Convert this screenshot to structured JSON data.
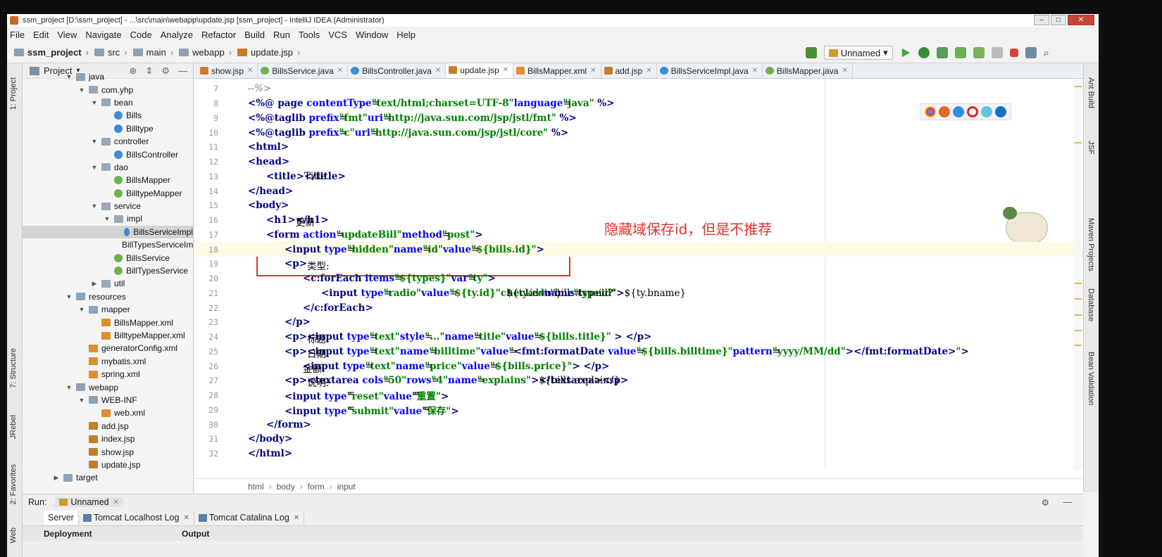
{
  "window": {
    "title": "ssm_project [D:\\ssm_project] - ...\\src\\main\\webapp\\update.jsp [ssm_project] - IntelliJ IDEA (Administrator)"
  },
  "menu": [
    "File",
    "Edit",
    "View",
    "Navigate",
    "Code",
    "Analyze",
    "Refactor",
    "Build",
    "Run",
    "Tools",
    "VCS",
    "Window",
    "Help"
  ],
  "nav": {
    "crumbs": [
      "ssm_project",
      "src",
      "main",
      "webapp",
      "update.jsp"
    ],
    "run_config": "Unnamed"
  },
  "left_tabs": [
    "1: Project",
    "7: Structure",
    "JRebel",
    "2: Favorites",
    "Web"
  ],
  "right_tabs": [
    "Ant Build",
    "JSF",
    "Maven Projects",
    "Database",
    "Bean Validation"
  ],
  "project": {
    "header": "Project",
    "tree": [
      {
        "label": "java",
        "indent": 0,
        "arrow": "down",
        "icon": "folder"
      },
      {
        "label": "com.yhp",
        "indent": 1,
        "arrow": "down",
        "icon": "pkg"
      },
      {
        "label": "bean",
        "indent": 2,
        "arrow": "down",
        "icon": "pkg"
      },
      {
        "label": "Bills",
        "indent": 3,
        "arrow": "",
        "icon": "cls"
      },
      {
        "label": "Billtype",
        "indent": 3,
        "arrow": "",
        "icon": "cls"
      },
      {
        "label": "controller",
        "indent": 2,
        "arrow": "down",
        "icon": "pkg"
      },
      {
        "label": "BillsController",
        "indent": 3,
        "arrow": "",
        "icon": "cls"
      },
      {
        "label": "dao",
        "indent": 2,
        "arrow": "down",
        "icon": "pkg"
      },
      {
        "label": "BillsMapper",
        "indent": 3,
        "arrow": "",
        "icon": "iface"
      },
      {
        "label": "BilltypeMapper",
        "indent": 3,
        "arrow": "",
        "icon": "iface"
      },
      {
        "label": "service",
        "indent": 2,
        "arrow": "down",
        "icon": "pkg"
      },
      {
        "label": "impl",
        "indent": 3,
        "arrow": "down",
        "icon": "pkg"
      },
      {
        "label": "BillsServiceImpl",
        "indent": 4,
        "arrow": "",
        "icon": "cls",
        "selected": true
      },
      {
        "label": "BillTypesServiceImpl",
        "indent": 4,
        "arrow": "",
        "icon": "cls"
      },
      {
        "label": "BillsService",
        "indent": 3,
        "arrow": "",
        "icon": "iface"
      },
      {
        "label": "BillTypesService",
        "indent": 3,
        "arrow": "",
        "icon": "iface"
      },
      {
        "label": "util",
        "indent": 2,
        "arrow": "right",
        "icon": "pkg"
      },
      {
        "label": "resources",
        "indent": 0,
        "arrow": "down",
        "icon": "folder"
      },
      {
        "label": "mapper",
        "indent": 1,
        "arrow": "down",
        "icon": "folder"
      },
      {
        "label": "BillsMapper.xml",
        "indent": 2,
        "arrow": "",
        "icon": "xml"
      },
      {
        "label": "BilltypeMapper.xml",
        "indent": 2,
        "arrow": "",
        "icon": "xml"
      },
      {
        "label": "generatorConfig.xml",
        "indent": 1,
        "arrow": "",
        "icon": "xml"
      },
      {
        "label": "mybatis.xml",
        "indent": 1,
        "arrow": "",
        "icon": "xml"
      },
      {
        "label": "spring.xml",
        "indent": 1,
        "arrow": "",
        "icon": "xml"
      },
      {
        "label": "webapp",
        "indent": 0,
        "arrow": "down",
        "icon": "folder"
      },
      {
        "label": "WEB-INF",
        "indent": 1,
        "arrow": "down",
        "icon": "folder"
      },
      {
        "label": "web.xml",
        "indent": 2,
        "arrow": "",
        "icon": "xml"
      },
      {
        "label": "add.jsp",
        "indent": 1,
        "arrow": "",
        "icon": "jsp"
      },
      {
        "label": "index.jsp",
        "indent": 1,
        "arrow": "",
        "icon": "jsp"
      },
      {
        "label": "show.jsp",
        "indent": 1,
        "arrow": "",
        "icon": "jsp"
      },
      {
        "label": "update.jsp",
        "indent": 1,
        "arrow": "",
        "icon": "jsp"
      },
      {
        "label": "target",
        "indent": -1,
        "arrow": "right",
        "icon": "folder"
      }
    ]
  },
  "tabs": [
    {
      "label": "show.jsp",
      "icon": "jsp"
    },
    {
      "label": "BillsService.java",
      "icon": "iface"
    },
    {
      "label": "BillsController.java",
      "icon": "cls"
    },
    {
      "label": "update.jsp",
      "icon": "jsp",
      "active": true
    },
    {
      "label": "BillsMapper.xml",
      "icon": "xml"
    },
    {
      "label": "add.jsp",
      "icon": "jsp"
    },
    {
      "label": "BillsServiceImpl.java",
      "icon": "cls"
    },
    {
      "label": "BillsMapper.java",
      "icon": "iface"
    }
  ],
  "code_lines": [
    {
      "n": "7",
      "indent": 0,
      "parts": [
        [
          "cmt",
          "--%>"
        ]
      ]
    },
    {
      "n": "8",
      "indent": 0,
      "parts": [
        [
          "tag",
          "<%@ page "
        ],
        [
          "attr",
          "contentType"
        ],
        [
          "txt",
          "="
        ],
        [
          "val",
          "\"text/html;charset=UTF-8\""
        ],
        [
          "txt",
          " "
        ],
        [
          "attr",
          "language"
        ],
        [
          "txt",
          "="
        ],
        [
          "val",
          "\"java\""
        ],
        [
          "tag",
          " %>"
        ]
      ]
    },
    {
      "n": "9",
      "indent": 0,
      "parts": [
        [
          "tag",
          "<%@taglib "
        ],
        [
          "attr",
          "prefix"
        ],
        [
          "txt",
          "="
        ],
        [
          "val",
          "\"fmt\""
        ],
        [
          "txt",
          " "
        ],
        [
          "attr",
          "uri"
        ],
        [
          "txt",
          "="
        ],
        [
          "val",
          "\"http://java.sun.com/jsp/jstl/fmt\""
        ],
        [
          "tag",
          " %>"
        ]
      ]
    },
    {
      "n": "10",
      "indent": 0,
      "parts": [
        [
          "tag",
          "<%@taglib "
        ],
        [
          "attr",
          "prefix"
        ],
        [
          "txt",
          "="
        ],
        [
          "val",
          "\"c\""
        ],
        [
          "txt",
          " "
        ],
        [
          "attr",
          "uri"
        ],
        [
          "txt",
          "="
        ],
        [
          "val",
          "\"http://java.sun.com/jsp/jstl/core\""
        ],
        [
          "tag",
          " %>"
        ]
      ]
    },
    {
      "n": "11",
      "indent": 0,
      "parts": [
        [
          "tag",
          "<html>"
        ]
      ]
    },
    {
      "n": "12",
      "indent": 0,
      "parts": [
        [
          "tag",
          "<head>"
        ]
      ]
    },
    {
      "n": "13",
      "indent": 1,
      "parts": [
        [
          "tag",
          "<title>"
        ],
        [
          "txt",
          "Title"
        ],
        [
          "tag",
          "</title>"
        ]
      ]
    },
    {
      "n": "14",
      "indent": 0,
      "parts": [
        [
          "tag",
          "</head>"
        ]
      ]
    },
    {
      "n": "15",
      "indent": 0,
      "parts": [
        [
          "tag",
          "<body>"
        ]
      ]
    },
    {
      "n": "16",
      "indent": 1,
      "parts": [
        [
          "tag",
          "<h1>"
        ],
        [
          "txt",
          "更新"
        ],
        [
          "tag",
          "</h1>"
        ]
      ]
    },
    {
      "n": "17",
      "indent": 1,
      "parts": [
        [
          "tag",
          "<form "
        ],
        [
          "attr",
          "action"
        ],
        [
          "txt",
          "="
        ],
        [
          "val",
          "\"updateBill\""
        ],
        [
          "txt",
          " "
        ],
        [
          "attr",
          "method"
        ],
        [
          "txt",
          "="
        ],
        [
          "val",
          "\"post\""
        ],
        [
          "tag",
          ">"
        ]
      ]
    },
    {
      "n": "18",
      "indent": 2,
      "current": true,
      "parts": [
        [
          "tag",
          "<input "
        ],
        [
          "attr",
          "type"
        ],
        [
          "txt",
          "="
        ],
        [
          "val",
          "\"hidden\""
        ],
        [
          "txt",
          " "
        ],
        [
          "attr",
          "name"
        ],
        [
          "txt",
          "="
        ],
        [
          "val",
          "\"id\""
        ],
        [
          "txt",
          " "
        ],
        [
          "attr",
          "value"
        ],
        [
          "txt",
          "="
        ],
        [
          "val",
          "\"${bills.id}\""
        ],
        [
          "tag",
          ">"
        ]
      ]
    },
    {
      "n": "19",
      "indent": 2,
      "parts": [
        [
          "tag",
          "<p>"
        ],
        [
          "txt",
          "类型:"
        ]
      ]
    },
    {
      "n": "20",
      "indent": 3,
      "parts": [
        [
          "tag",
          "<c:forEach "
        ],
        [
          "attr",
          "items"
        ],
        [
          "txt",
          "="
        ],
        [
          "val",
          "\"${types}\""
        ],
        [
          "txt",
          " "
        ],
        [
          "attr",
          "var"
        ],
        [
          "txt",
          "="
        ],
        [
          "val",
          "\"ty\""
        ],
        [
          "tag",
          ">"
        ]
      ]
    },
    {
      "n": "21",
      "indent": 4,
      "parts": [
        [
          "tag",
          "<input "
        ],
        [
          "attr",
          "type"
        ],
        [
          "txt",
          "="
        ],
        [
          "val",
          "\"radio\""
        ],
        [
          "txt",
          " "
        ],
        [
          "attr",
          "value"
        ],
        [
          "txt",
          "="
        ],
        [
          "val",
          "\"${ty.id}\""
        ],
        [
          "txt",
          "  ${ty.id==bills.typeid?'"
        ],
        [
          "val",
          "checked"
        ],
        [
          "txt",
          "':''}   "
        ],
        [
          "attr",
          "name"
        ],
        [
          "txt",
          "="
        ],
        [
          "val",
          "\"typeid\""
        ],
        [
          "tag",
          ">"
        ],
        [
          "txt",
          "${ty.bname}"
        ]
      ]
    },
    {
      "n": "22",
      "indent": 3,
      "parts": [
        [
          "tag",
          "</c:forEach>"
        ]
      ]
    },
    {
      "n": "23",
      "indent": 2,
      "parts": [
        [
          "tag",
          "</p>"
        ]
      ]
    },
    {
      "n": "24",
      "indent": 2,
      "parts": [
        [
          "tag",
          "<p>"
        ],
        [
          "txt",
          "标题:"
        ],
        [
          "tag",
          "<input "
        ],
        [
          "attr",
          "type"
        ],
        [
          "txt",
          "="
        ],
        [
          "val",
          "\"text\""
        ],
        [
          "txt",
          " "
        ],
        [
          "attr",
          "style"
        ],
        [
          "txt",
          "="
        ],
        [
          "val",
          "\"...\""
        ],
        [
          "txt",
          " "
        ],
        [
          "attr",
          "name"
        ],
        [
          "txt",
          "="
        ],
        [
          "val",
          "\"title\""
        ],
        [
          "txt",
          " "
        ],
        [
          "attr",
          "value"
        ],
        [
          "txt",
          "="
        ],
        [
          "val",
          "\"${bills.title}\""
        ],
        [
          "tag",
          " > </p>"
        ]
      ]
    },
    {
      "n": "25",
      "indent": 2,
      "parts": [
        [
          "tag",
          "<p>"
        ],
        [
          "txt",
          "日期: "
        ],
        [
          "tag",
          "<input "
        ],
        [
          "attr",
          "type"
        ],
        [
          "txt",
          "="
        ],
        [
          "val",
          "\"text\""
        ],
        [
          "txt",
          " "
        ],
        [
          "attr",
          "name"
        ],
        [
          "txt",
          "="
        ],
        [
          "val",
          "\"billtime\""
        ],
        [
          "txt",
          " "
        ],
        [
          "attr",
          "value"
        ],
        [
          "txt",
          "="
        ],
        [
          "val",
          "\""
        ],
        [
          "tag",
          "<fmt:formatDate "
        ],
        [
          "attr",
          "value"
        ],
        [
          "txt",
          "="
        ],
        [
          "val",
          "\"${bills.billtime}\""
        ],
        [
          "txt",
          " "
        ],
        [
          "attr",
          "pattern"
        ],
        [
          "txt",
          "="
        ],
        [
          "val",
          "\"yyyy/MM/dd\""
        ],
        [
          "tag",
          "></fmt:formatDate>"
        ],
        [
          "val",
          "\""
        ],
        [
          "tag",
          ">"
        ]
      ]
    },
    {
      "n": "26",
      "indent": 3,
      "parts": [
        [
          "txt",
          "金额:"
        ],
        [
          "tag",
          "<input "
        ],
        [
          "attr",
          "type"
        ],
        [
          "txt",
          "="
        ],
        [
          "val",
          "\"text\""
        ],
        [
          "txt",
          " "
        ],
        [
          "attr",
          "name"
        ],
        [
          "txt",
          "="
        ],
        [
          "val",
          "\"price\""
        ],
        [
          "txt",
          " "
        ],
        [
          "attr",
          "value"
        ],
        [
          "txt",
          "="
        ],
        [
          "val",
          "\"${bills.price}\""
        ],
        [
          "tag",
          "> </p>"
        ]
      ]
    },
    {
      "n": "27",
      "indent": 2,
      "parts": [
        [
          "tag",
          "<p>"
        ],
        [
          "txt",
          "说明:"
        ],
        [
          "tag",
          "<textarea "
        ],
        [
          "attr",
          "cols"
        ],
        [
          "txt",
          "="
        ],
        [
          "val",
          "\"50\""
        ],
        [
          "txt",
          " "
        ],
        [
          "attr",
          "rows"
        ],
        [
          "txt",
          "="
        ],
        [
          "val",
          "\"4\""
        ],
        [
          "txt",
          " "
        ],
        [
          "attr",
          "name"
        ],
        [
          "txt",
          "="
        ],
        [
          "val",
          "\"explains\""
        ],
        [
          "tag",
          ">"
        ],
        [
          "txt",
          "${bills.explains}"
        ],
        [
          "tag",
          "</textarea></p>"
        ]
      ]
    },
    {
      "n": "28",
      "indent": 2,
      "parts": [
        [
          "tag",
          "<input "
        ],
        [
          "attr",
          "type"
        ],
        [
          "txt",
          "="
        ],
        [
          "val",
          "\"reset\""
        ],
        [
          "txt",
          " "
        ],
        [
          "attr",
          "value"
        ],
        [
          "txt",
          "="
        ],
        [
          "val",
          "\"重置\""
        ],
        [
          "tag",
          ">"
        ]
      ]
    },
    {
      "n": "29",
      "indent": 2,
      "parts": [
        [
          "tag",
          "<input "
        ],
        [
          "attr",
          "type"
        ],
        [
          "txt",
          "="
        ],
        [
          "val",
          "\"submit\""
        ],
        [
          "txt",
          " "
        ],
        [
          "attr",
          "value"
        ],
        [
          "txt",
          "="
        ],
        [
          "val",
          "\"保存\""
        ],
        [
          "tag",
          ">"
        ]
      ]
    },
    {
      "n": "30",
      "indent": 1,
      "parts": [
        [
          "tag",
          "</form>"
        ]
      ]
    },
    {
      "n": "31",
      "indent": 0,
      "parts": [
        [
          "tag",
          "</body>"
        ]
      ]
    },
    {
      "n": "32",
      "indent": 0,
      "parts": [
        [
          "tag",
          "</html>"
        ]
      ]
    }
  ],
  "annotation": "隐藏域保存id，但是不推荐",
  "editor_breadcrumb": [
    "html",
    "body",
    "form",
    "input"
  ],
  "run_panel": {
    "label": "Run:",
    "config": "Unnamed",
    "tabs": [
      "Server",
      "Tomcat Localhost Log",
      "Tomcat Catalina Log"
    ],
    "columns": [
      "Deployment",
      "Output"
    ]
  },
  "colors": {
    "annotation": "#e4312a",
    "tag": "#000080",
    "attr": "#0000ff",
    "string": "#008000"
  }
}
